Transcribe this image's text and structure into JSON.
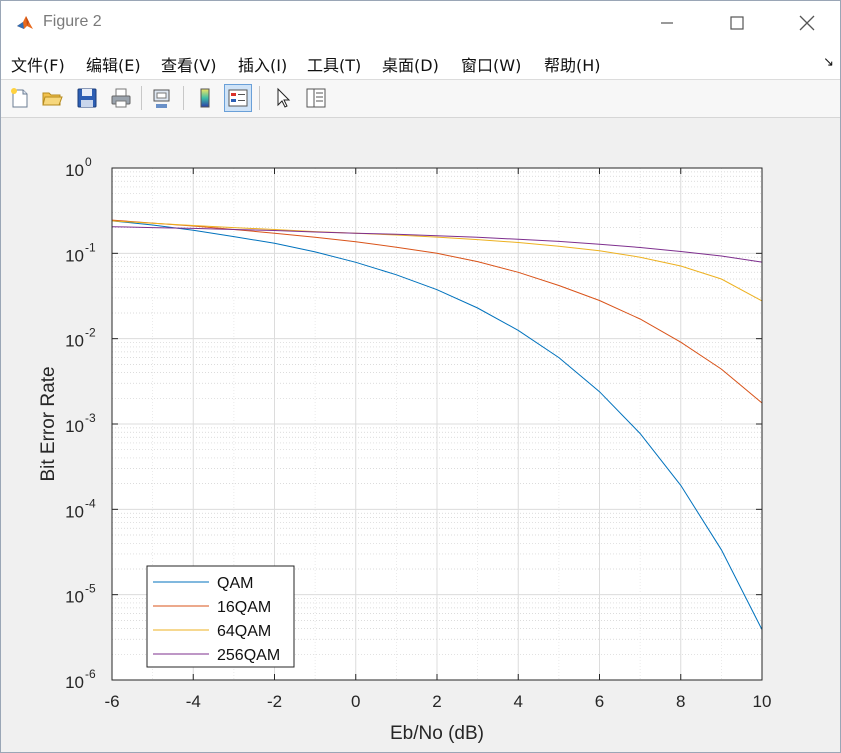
{
  "window": {
    "title": "Figure 2",
    "minimize_icon": "minimize-icon",
    "maximize_icon": "maximize-icon",
    "close_icon": "close-icon"
  },
  "menu": {
    "items": [
      "文件(F)",
      "编辑(E)",
      "查看(V)",
      "插入(I)",
      "工具(T)",
      "桌面(D)",
      "窗口(W)",
      "帮助(H)"
    ],
    "corner_glyph": "↘"
  },
  "toolbar": {
    "buttons": [
      "new-figure-icon",
      "open-file-icon",
      "save-icon",
      "print-icon",
      "link-plot-icon",
      "colorbar-icon",
      "legend-icon",
      "edit-plot-arrow-icon",
      "property-inspector-icon"
    ]
  },
  "chart_data": {
    "type": "line",
    "title": "",
    "xlabel": "Eb/No (dB)",
    "ylabel": "Bit Error Rate",
    "xlim": [
      -6,
      10
    ],
    "ylim": [
      1e-06,
      1
    ],
    "yscale": "log",
    "grid": true,
    "minor_grid": true,
    "legend_position": "bottom-left",
    "xticks": [
      "-6",
      "-4",
      "-2",
      "0",
      "2",
      "4",
      "6",
      "8",
      "10"
    ],
    "yticks": [
      {
        "base": "10",
        "exp": "0"
      },
      {
        "base": "10",
        "exp": "-1"
      },
      {
        "base": "10",
        "exp": "-2"
      },
      {
        "base": "10",
        "exp": "-3"
      },
      {
        "base": "10",
        "exp": "-4"
      },
      {
        "base": "10",
        "exp": "-5"
      },
      {
        "base": "10",
        "exp": "-6"
      }
    ],
    "x": [
      -6,
      -5,
      -4,
      -3,
      -2,
      -1,
      0,
      1,
      2,
      3,
      4,
      5,
      6,
      7,
      8,
      9,
      10
    ],
    "series": [
      {
        "name": "QAM",
        "color": "#0072bd",
        "values": [
          0.24,
          0.215,
          0.186,
          0.157,
          0.131,
          0.104,
          0.0786,
          0.056,
          0.0375,
          0.0229,
          0.0125,
          0.006,
          0.00239,
          0.000773,
          0.000191,
          3.36e-05,
          3.9e-06
        ]
      },
      {
        "name": "16QAM",
        "color": "#d95319",
        "values": [
          0.245,
          0.226,
          0.209,
          0.19,
          0.172,
          0.154,
          0.137,
          0.118,
          0.1,
          0.08,
          0.06,
          0.042,
          0.028,
          0.017,
          0.0091,
          0.0044,
          0.00176
        ]
      },
      {
        "name": "64QAM",
        "color": "#edb120",
        "values": [
          0.24,
          0.225,
          0.212,
          0.2,
          0.19,
          0.18,
          0.172,
          0.164,
          0.155,
          0.145,
          0.134,
          0.121,
          0.107,
          0.09,
          0.071,
          0.05,
          0.0277
        ]
      },
      {
        "name": "256QAM",
        "color": "#7e2f8e",
        "values": [
          0.205,
          0.2,
          0.196,
          0.19,
          0.185,
          0.178,
          0.172,
          0.167,
          0.161,
          0.154,
          0.146,
          0.138,
          0.128,
          0.117,
          0.105,
          0.093,
          0.079
        ]
      }
    ]
  }
}
